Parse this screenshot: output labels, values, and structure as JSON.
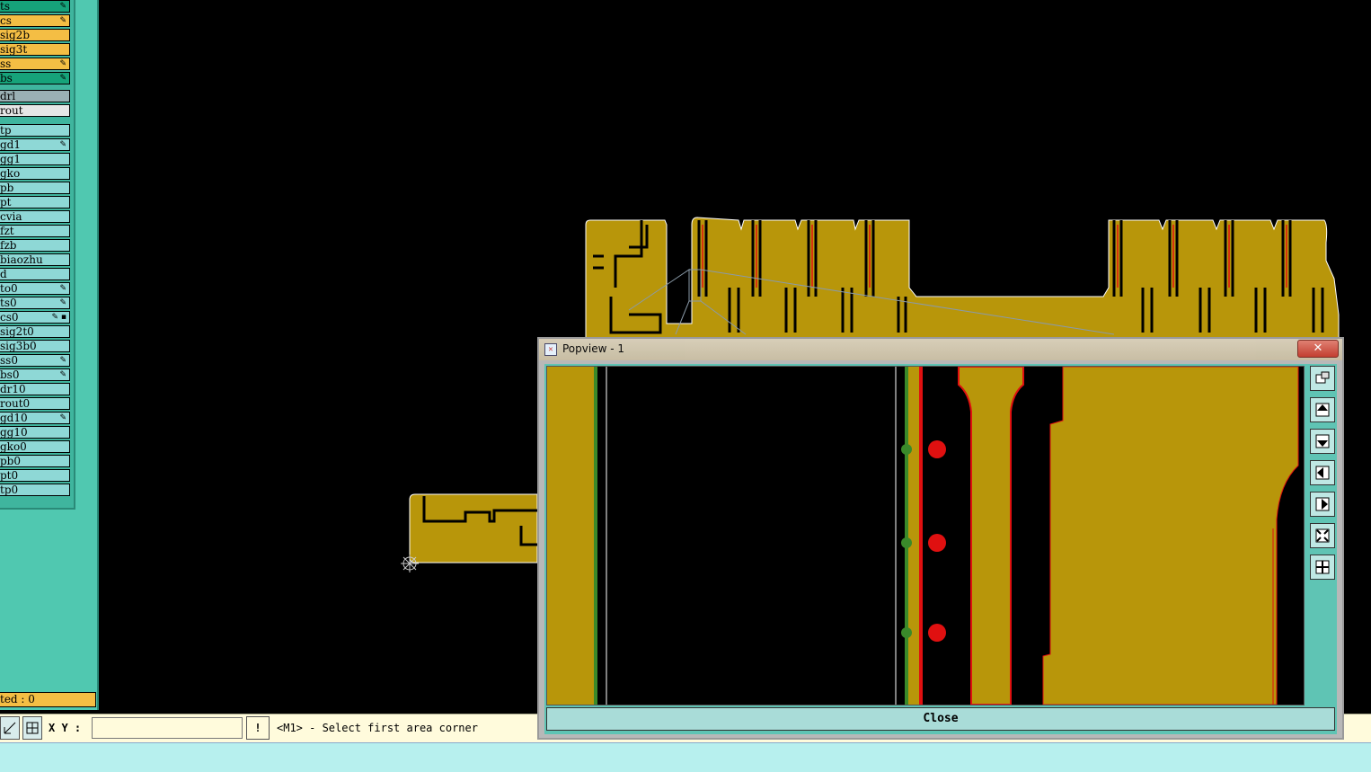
{
  "layers": {
    "group_top": [
      {
        "label": "ts",
        "color": "green",
        "flag": "✎"
      },
      {
        "label": "cs",
        "color": "orange",
        "flag": "✎"
      },
      {
        "label": "sig2b",
        "color": "orange",
        "flag": ""
      },
      {
        "label": "sig3t",
        "color": "orange",
        "flag": ""
      },
      {
        "label": "ss",
        "color": "orange",
        "flag": "✎"
      },
      {
        "label": "bs",
        "color": "green",
        "flag": "✎"
      }
    ],
    "group_mid": [
      {
        "label": "drl",
        "color": "grey",
        "flag": ""
      },
      {
        "label": "rout",
        "color": "white",
        "flag": ""
      }
    ],
    "group_bottom": [
      {
        "label": "tp",
        "color": "cyan",
        "flag": ""
      },
      {
        "label": "gd1",
        "color": "cyan",
        "flag": "✎"
      },
      {
        "label": "gg1",
        "color": "cyan",
        "flag": ""
      },
      {
        "label": "gko",
        "color": "cyan",
        "flag": ""
      },
      {
        "label": "pb",
        "color": "cyan",
        "flag": ""
      },
      {
        "label": "pt",
        "color": "cyan",
        "flag": ""
      },
      {
        "label": "cvia",
        "color": "cyan",
        "flag": ""
      },
      {
        "label": "fzt",
        "color": "cyan",
        "flag": ""
      },
      {
        "label": "fzb",
        "color": "cyan",
        "flag": ""
      },
      {
        "label": "biaozhu",
        "color": "cyan",
        "flag": ""
      },
      {
        "label": "d",
        "color": "cyan",
        "flag": ""
      },
      {
        "label": "to0",
        "color": "cyan",
        "flag": "✎"
      },
      {
        "label": "ts0",
        "color": "cyan",
        "flag": "✎"
      },
      {
        "label": "cs0",
        "color": "cyan",
        "flag": "✎ ▪"
      },
      {
        "label": "sig2t0",
        "color": "cyan",
        "flag": ""
      },
      {
        "label": "sig3b0",
        "color": "cyan",
        "flag": ""
      },
      {
        "label": "ss0",
        "color": "cyan",
        "flag": "✎"
      },
      {
        "label": "bs0",
        "color": "cyan",
        "flag": "✎"
      },
      {
        "label": "dr10",
        "color": "cyan",
        "flag": ""
      },
      {
        "label": "rout0",
        "color": "cyan",
        "flag": ""
      },
      {
        "label": "gd10",
        "color": "cyan",
        "flag": "✎"
      },
      {
        "label": "gg10",
        "color": "cyan",
        "flag": ""
      },
      {
        "label": "gko0",
        "color": "cyan",
        "flag": ""
      },
      {
        "label": "pb0",
        "color": "cyan",
        "flag": ""
      },
      {
        "label": "pt0",
        "color": "cyan",
        "flag": ""
      },
      {
        "label": "tp0",
        "color": "cyan",
        "flag": ""
      }
    ]
  },
  "selected_label": "ted : 0",
  "toolbar": {
    "xy_label": "X Y :",
    "xy_value": "",
    "warn_label": "!",
    "prompt": "<M1> - Select first area corner"
  },
  "popview": {
    "title": "Popview - 1",
    "close_x": "✕",
    "close_button": "Close",
    "tools": [
      "zoom-window-icon",
      "pan-up-icon",
      "pan-down-icon",
      "pan-left-icon",
      "pan-right-icon",
      "zoom-fit-icon",
      "zoom-home-icon"
    ]
  },
  "colors": {
    "copper": "#b8960a",
    "panel": "#50c8b0",
    "layer_green": "#16a37a",
    "layer_orange": "#f4be44",
    "layer_cyan": "#8ed8d6",
    "drill_red": "#e01010"
  }
}
